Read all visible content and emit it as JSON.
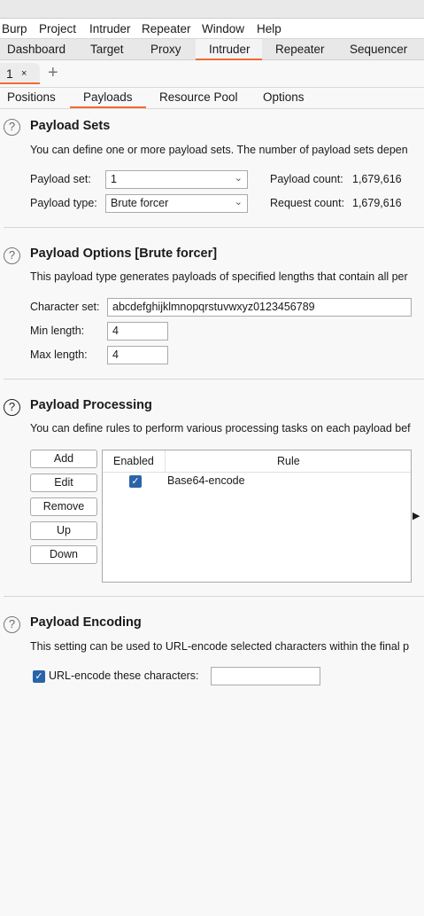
{
  "menu": [
    "Burp",
    "Project",
    "Intruder",
    "Repeater",
    "Window",
    "Help"
  ],
  "main_tabs": [
    "Dashboard",
    "Target",
    "Proxy",
    "Intruder",
    "Repeater",
    "Sequencer"
  ],
  "instance_tab": {
    "label": "1",
    "close": "×",
    "add": "+"
  },
  "payload_tabs": [
    "Positions",
    "Payloads",
    "Resource Pool",
    "Options"
  ],
  "payload_sets": {
    "title": "Payload Sets",
    "desc": "You can define one or more payload sets. The number of payload sets depen",
    "set_label": "Payload set:",
    "set_value": "1",
    "type_label": "Payload type:",
    "type_value": "Brute forcer",
    "count_label": "Payload count:",
    "count_value": "1,679,616",
    "req_label": "Request count:",
    "req_value": "1,679,616"
  },
  "payload_options": {
    "title": "Payload Options [Brute forcer]",
    "desc": "This payload type generates payloads of specified lengths that contain all per",
    "charset_label": "Character set:",
    "charset_value": "abcdefghijklmnopqrstuvwxyz0123456789",
    "min_label": "Min length:",
    "min_value": "4",
    "max_label": "Max length:",
    "max_value": "4"
  },
  "payload_processing": {
    "title": "Payload Processing",
    "desc": "You can define rules to perform various processing tasks on each payload bef",
    "buttons": [
      "Add",
      "Edit",
      "Remove",
      "Up",
      "Down"
    ],
    "columns": [
      "Enabled",
      "Rule"
    ],
    "rows": [
      {
        "enabled": true,
        "rule": "Base64-encode"
      }
    ]
  },
  "payload_encoding": {
    "title": "Payload Encoding",
    "desc": "This setting can be used to URL-encode selected characters within the final p",
    "checkbox_label": "URL-encode these characters:",
    "checked": true,
    "value": ""
  },
  "colors": {
    "accent": "#f26a35",
    "checkbox": "#2a64a8"
  }
}
